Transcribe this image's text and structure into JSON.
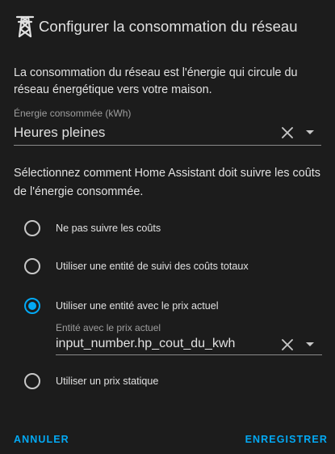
{
  "dialog": {
    "title": "Configurer la consommation du réseau",
    "header_icon": "transmission-tower-icon",
    "description": "La consommation du réseau est l'énergie qui circule du réseau énergétique vers votre maison."
  },
  "energy_field": {
    "label": "Énergie consommée (kWh)",
    "value": "Heures pleines",
    "clear_icon": "close-icon",
    "dropdown_icon": "menu-down-icon"
  },
  "cost_section": {
    "text": "Sélectionnez comment Home Assistant doit suivre les coûts de l'énergie consommée.",
    "options": [
      {
        "label": "Ne pas suivre les coûts",
        "checked": false
      },
      {
        "label": "Utiliser une entité de suivi des coûts totaux",
        "checked": false
      },
      {
        "label": "Utiliser une entité avec le prix actuel",
        "checked": true
      },
      {
        "label": "Utiliser un prix statique",
        "checked": false
      }
    ]
  },
  "price_field": {
    "label": "Entité avec le prix actuel",
    "value": "input_number.hp_cout_du_kwh",
    "clear_icon": "close-icon",
    "dropdown_icon": "menu-down-icon"
  },
  "actions": {
    "cancel_label": "ANNULER",
    "save_label": "ENREGISTRER"
  },
  "colors": {
    "background": "#1c1c1c",
    "accent": "#03a9f4",
    "text": "#e1e1e1",
    "secondary_text": "#9e9e9e"
  }
}
